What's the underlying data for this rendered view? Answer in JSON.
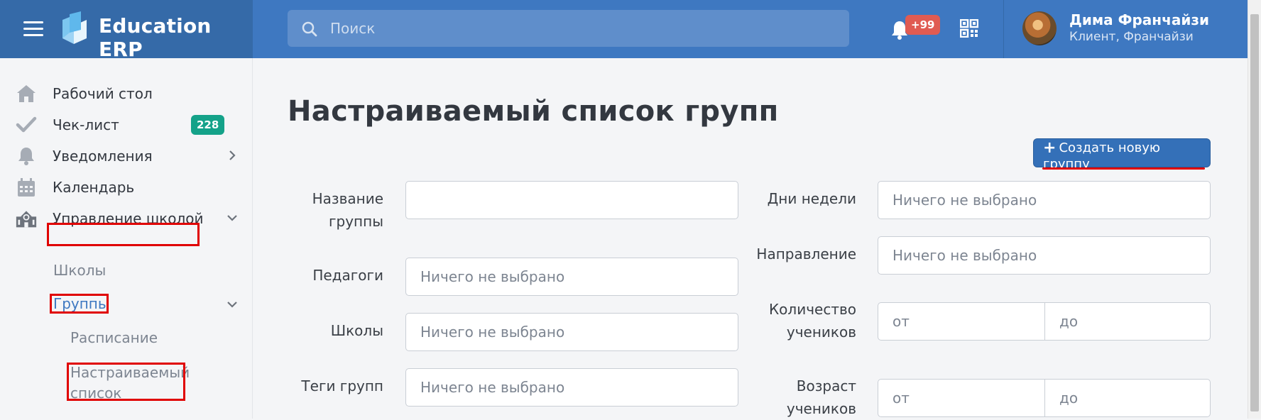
{
  "header": {
    "brand": "Education ERP",
    "search_placeholder": "Поиск",
    "notifications_badge": "+99",
    "user_name": "Дима Франчайзи",
    "user_role": "Клиент, Франчайзи"
  },
  "sidebar": {
    "items": [
      {
        "label": "Рабочий стол",
        "icon": "home-icon"
      },
      {
        "label": "Чек-лист",
        "icon": "check-icon",
        "badge": "228"
      },
      {
        "label": "Уведомления",
        "icon": "bell-icon"
      },
      {
        "label": "Календарь",
        "icon": "calendar-icon"
      },
      {
        "label": "Управление школой",
        "icon": "school-icon"
      }
    ],
    "sub_items": {
      "schools": "Школы",
      "groups": "Группы",
      "schedule": "Расписание",
      "custom_list_line1": "Настраиваемый",
      "custom_list_line2": "список"
    }
  },
  "main": {
    "title": "Настраиваемый список групп",
    "create_button": "Создать новую группу",
    "filters": {
      "group_name_l1": "Название",
      "group_name_l2": "группы",
      "group_name_value": "",
      "teachers": "Педагоги",
      "schools": "Школы",
      "group_tags": "Теги групп",
      "weekdays": "Дни недели",
      "direction": "Направление",
      "students_count_l1": "Количество",
      "students_count_l2": "учеников",
      "students_age_l1": "Возраст",
      "students_age_l2": "учеников",
      "nothing_selected": "Ничего не выбрано",
      "from": "от",
      "to": "до"
    }
  },
  "colors": {
    "header": "#3e78c1",
    "brand_bg": "#356aa8",
    "accent_button": "#3470b8",
    "badge_green": "#14a289",
    "badge_red": "#e05b52",
    "annotation_red": "#e00000"
  }
}
